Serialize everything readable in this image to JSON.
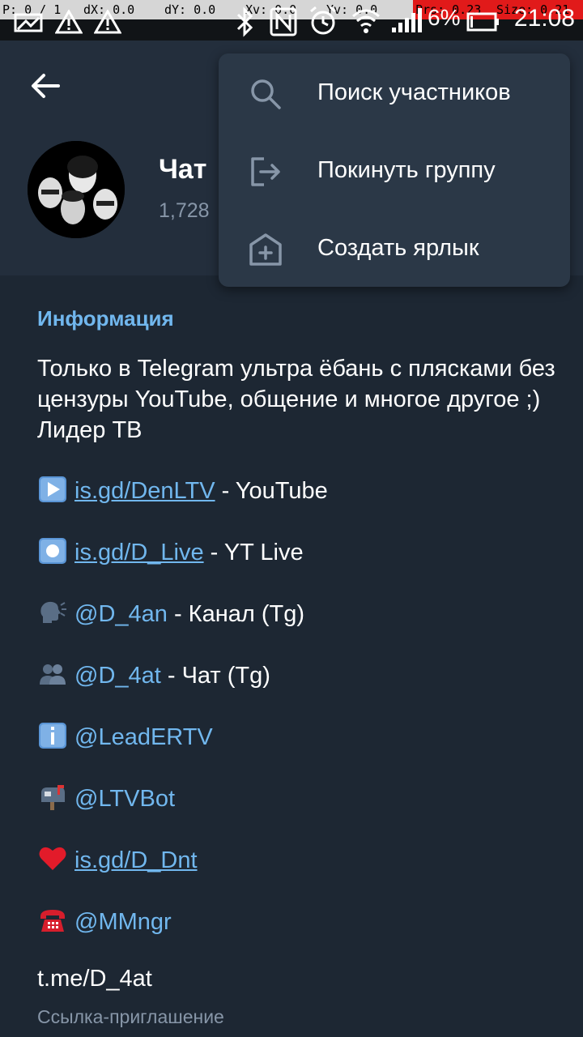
{
  "status_bar": {
    "debug": [
      "P: 0 / 1",
      "dX: 0.0",
      "dY: 0.0",
      "Xv: 0.0",
      "Yv: 0.0",
      "Prs: 0.23",
      "Size: 0.21"
    ],
    "battery": "6%",
    "time": "21:08"
  },
  "header": {
    "title": "Чат",
    "members": "1,728"
  },
  "menu": {
    "items": [
      {
        "label": "Поиск участников",
        "icon": "search-icon"
      },
      {
        "label": "Покинуть группу",
        "icon": "leave-icon"
      },
      {
        "label": "Создать ярлык",
        "icon": "add-shortcut-icon"
      }
    ]
  },
  "info": {
    "section_title": "Информация",
    "description": "Только в Telegram ультра ёбань с плясками без цензуры YouTube, общение и многое другое ;) Лидер ТВ",
    "lines": [
      {
        "emoji": "play-button-icon",
        "link": "is.gd/DenLTV",
        "text": " - YouTube"
      },
      {
        "emoji": "record-button-icon",
        "link": "is.gd/D_Live",
        "text": " - YT Live"
      },
      {
        "emoji": "speaking-head-icon",
        "mention": "@D_4an",
        "text": " - Канал (Tg)"
      },
      {
        "emoji": "busts-icon",
        "mention": "@D_4at",
        "text": " - Чат (Tg)"
      },
      {
        "emoji": "info-icon",
        "mention": "@LeadERTV",
        "text": ""
      },
      {
        "emoji": "mailbox-icon",
        "mention": "@LTVBot",
        "text": ""
      },
      {
        "emoji": "heart-icon",
        "link": "is.gd/D_Dnt",
        "text": ""
      },
      {
        "emoji": "telephone-icon",
        "mention": "@MMngr",
        "text": ""
      }
    ],
    "invite_link": "t.me/D_4at",
    "invite_label": "Ссылка-приглашение"
  },
  "colors": {
    "background": "#1d2733",
    "header": "#232e3c",
    "menu": "#2b3847",
    "accent": "#71b7ee",
    "muted": "#8796a8"
  }
}
